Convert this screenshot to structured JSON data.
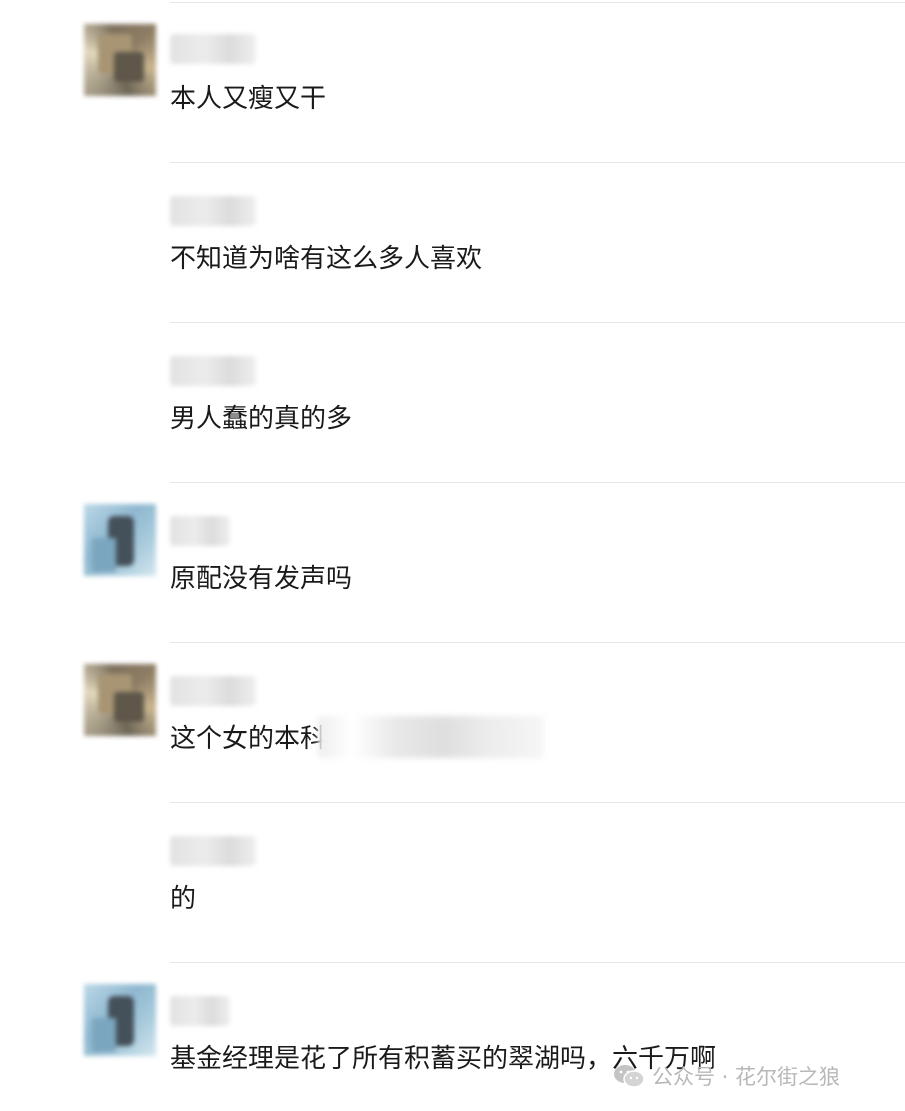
{
  "comments": [
    {
      "avatar": "avatar-a",
      "text": "本人又瘦又干"
    },
    {
      "avatar": null,
      "text": "不知道为啥有这么多人喜欢"
    },
    {
      "avatar": null,
      "text": "男人蠢的真的多"
    },
    {
      "avatar": "avatar-b",
      "text": "原配没有发声吗"
    },
    {
      "avatar": "avatar-a",
      "text": "这个女的本科"
    },
    {
      "avatar": null,
      "text": "的"
    },
    {
      "avatar": "avatar-b",
      "text": "基金经理是花了所有积蓄买的翠湖吗，六千万啊"
    }
  ],
  "watermark": {
    "icon": "wechat-icon",
    "text": "公众号 · 花尔街之狼"
  }
}
